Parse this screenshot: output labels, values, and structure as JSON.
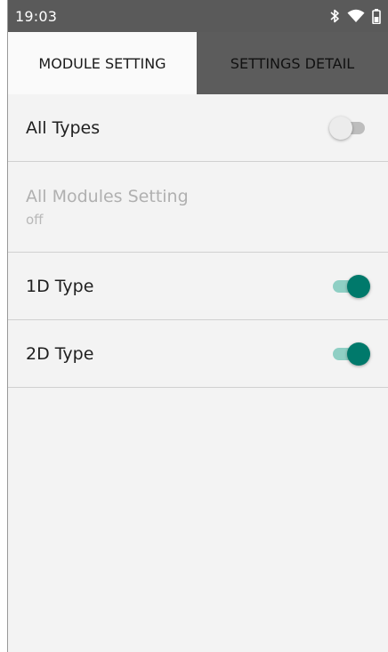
{
  "status_bar": {
    "time": "19:03",
    "icons": [
      "bluetooth-icon",
      "wifi-icon",
      "battery-icon"
    ],
    "background": "#5a5a5a"
  },
  "tabs": [
    {
      "label": "MODULE SETTING",
      "active": true
    },
    {
      "label": "SETTINGS DETAIL",
      "active": false
    }
  ],
  "settings": {
    "all_types": {
      "label": "All Types",
      "enabled": false
    },
    "all_modules": {
      "label": "All Modules Setting",
      "value": "off",
      "disabled": true
    },
    "type_1d": {
      "label": "1D Type",
      "enabled": true
    },
    "type_2d": {
      "label": "2D Type",
      "enabled": true
    }
  },
  "colors": {
    "accent": "#00796b",
    "accent_track": "#8fcfc4",
    "inactive_tab": "#5c5c5c"
  }
}
